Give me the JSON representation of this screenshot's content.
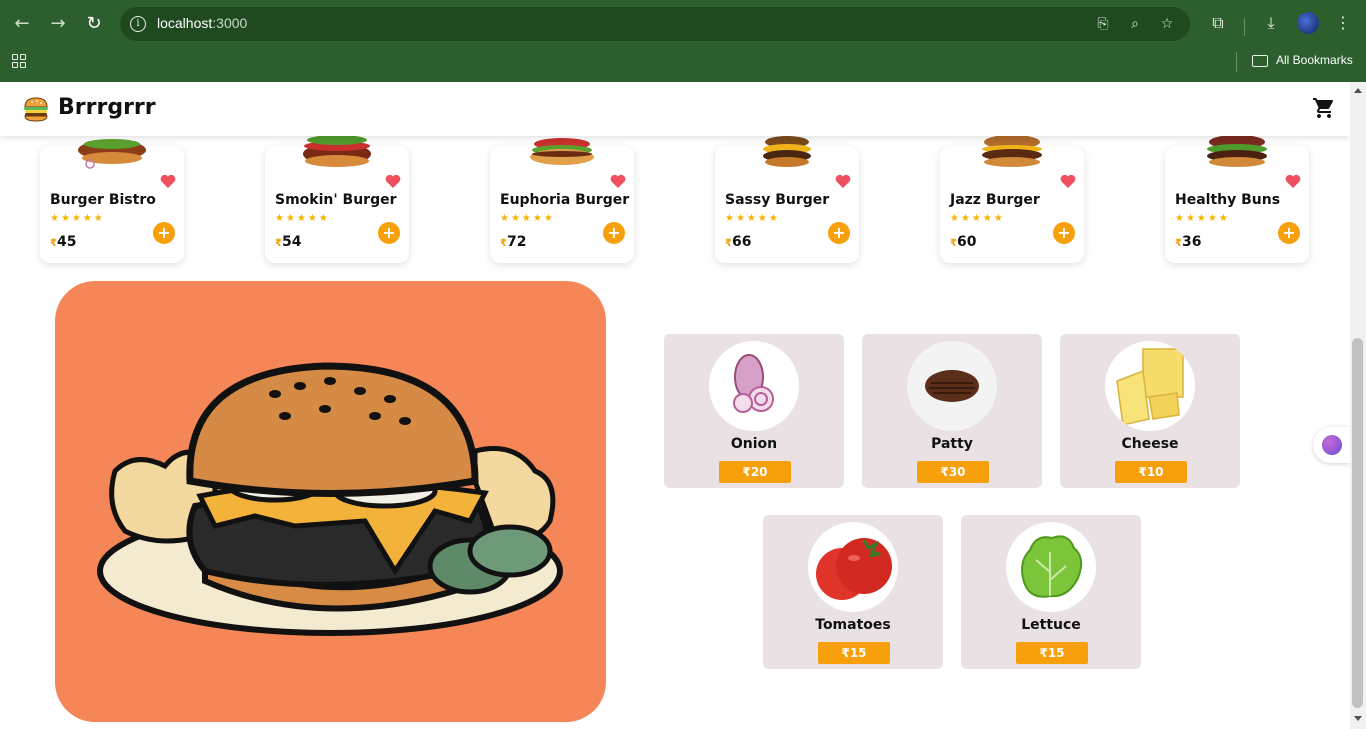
{
  "browser": {
    "url_host": "localhost",
    "url_port": ":3000",
    "bookmarks_label": "All Bookmarks"
  },
  "navbar": {
    "brand": "Brrrgrrr",
    "logo_icon": "burger-logo-icon",
    "cart_icon": "cart-icon"
  },
  "products": [
    {
      "name": "Burger Bistro",
      "price": "45",
      "currency": "₹",
      "rating": 5
    },
    {
      "name": "Smokin' Burger",
      "price": "54",
      "currency": "₹",
      "rating": 5
    },
    {
      "name": "Euphoria Burger",
      "price": "72",
      "currency": "₹",
      "rating": 5
    },
    {
      "name": "Sassy Burger",
      "price": "66",
      "currency": "₹",
      "rating": 5
    },
    {
      "name": "Jazz Burger",
      "price": "60",
      "currency": "₹",
      "rating": 5
    },
    {
      "name": "Healthy Buns",
      "price": "36",
      "currency": "₹",
      "rating": 5
    }
  ],
  "ingredients": [
    {
      "name": "Onion",
      "price": "₹20"
    },
    {
      "name": "Patty",
      "price": "₹30"
    },
    {
      "name": "Cheese",
      "price": "₹10"
    },
    {
      "name": "Tomatoes",
      "price": "₹15"
    },
    {
      "name": "Lettuce",
      "price": "₹15"
    }
  ],
  "colors": {
    "accent": "#f7a00c",
    "hero_bg": "#f48657",
    "ingredient_card": "#e9e1e3",
    "heart": "#ef4f5f",
    "chrome": "#2c5f2d"
  }
}
